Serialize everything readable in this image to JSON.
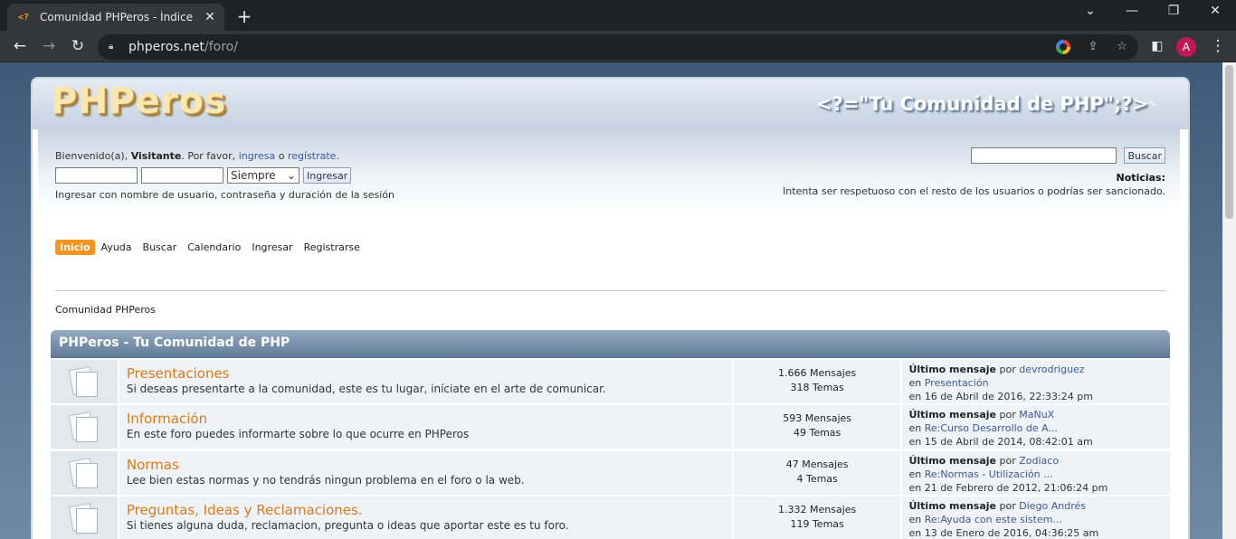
{
  "browser": {
    "tab_title": "Comunidad PHPeros - Índice",
    "favicon_text": "<?",
    "url_host": "phperos.net",
    "url_path": "/foro/",
    "profile_initial": "A"
  },
  "site": {
    "logo": "PHPeros",
    "slogan": "<?=\"Tu Comunidad de PHP\";?>"
  },
  "userbar": {
    "welcome_prefix": "Bienvenido(a), ",
    "visitor": "Visitante",
    "welcome_mid": ". Por favor, ",
    "login_link": "ingresa",
    "or": " o ",
    "register_link": "regístrate",
    "period": ".",
    "session_option": "Siempre",
    "login_button": "Ingresar",
    "login_hint": "Ingresar con nombre de usuario, contraseña y duración de la sesión",
    "search_button": "Buscar",
    "news_title": "Noticias:",
    "news_text": "Intenta ser respetuoso con el resto de los usuarios o podrías ser sancionado."
  },
  "menu": [
    "Inicio",
    "Ayuda",
    "Buscar",
    "Calendario",
    "Ingresar",
    "Registrarse"
  ],
  "breadcrumb": "Comunidad PHPeros",
  "category": "PHPeros - Tu Comunidad de PHP",
  "boards": [
    {
      "title": "Presentaciones",
      "desc": "Si deseas presentarte a la comunidad, este es tu lugar, iníciate en el arte de comunicar.",
      "posts": "1.666 Mensajes",
      "topics": "318 Temas",
      "last_label": "Último mensaje",
      "by": " por ",
      "author": "devrodriguez",
      "in": "en ",
      "topic": "Presentación",
      "date": "en 16 de Abril de 2016, 22:33:24 pm"
    },
    {
      "title": "Información",
      "desc": "En este foro puedes informarte sobre lo que ocurre en PHPeros",
      "posts": "593 Mensajes",
      "topics": "49 Temas",
      "last_label": "Último mensaje",
      "by": " por ",
      "author": "MaNuX",
      "in": "en ",
      "topic": "Re:Curso Desarrollo de A...",
      "date": "en 15 de Abril de 2014, 08:42:01 am"
    },
    {
      "title": "Normas",
      "desc": "Lee bien estas normas y no tendrás ningun problema en el foro o la web.",
      "posts": "47 Mensajes",
      "topics": "4 Temas",
      "last_label": "Último mensaje",
      "by": " por ",
      "author": "Zodiaco",
      "in": "en ",
      "topic": "Re:Normas - Utilización ...",
      "date": "en 21 de Febrero de 2012, 21:06:24 pm"
    },
    {
      "title": "Preguntas, Ideas y Reclamaciones.",
      "desc": "Si tienes alguna duda, reclamacion, pregunta o ideas que aportar este es tu foro.",
      "posts": "1.332 Mensajes",
      "topics": "119 Temas",
      "last_label": "Último mensaje",
      "by": " por ",
      "author": "Diego Andrés",
      "in": "en ",
      "topic": "Re:Ayuda con este sistem...",
      "date": "en 13 de Enero de 2016, 04:36:25 am"
    }
  ]
}
